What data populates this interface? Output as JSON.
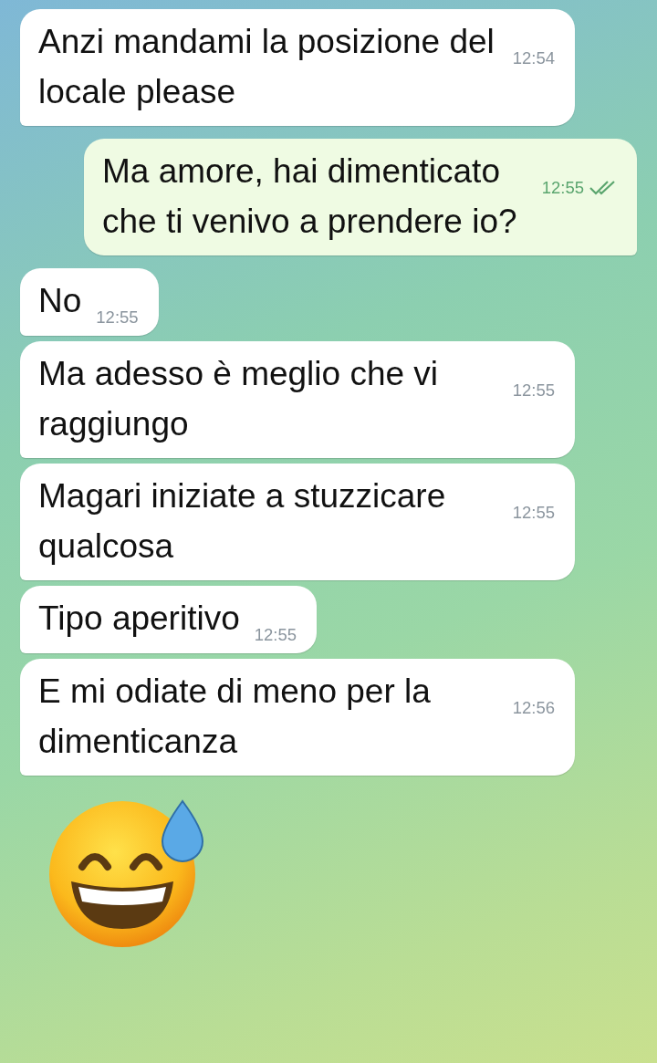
{
  "messages": [
    {
      "kind": "incoming",
      "text": "Anzi mandami la posizione del locale please",
      "time": "12:54"
    },
    {
      "kind": "outgoing",
      "text": "Ma amore, hai dimenticato che ti venivo a prendere io?",
      "time": "12:55",
      "read": true
    },
    {
      "kind": "incoming",
      "text": "No",
      "time": "12:55"
    },
    {
      "kind": "incoming",
      "text": "Ma adesso è meglio che vi raggiungo",
      "time": "12:55"
    },
    {
      "kind": "incoming",
      "text": "Magari iniziate a stuzzicare qualcosa",
      "time": "12:55"
    },
    {
      "kind": "incoming",
      "text": "Tipo aperitivo",
      "time": "12:55"
    },
    {
      "kind": "incoming",
      "text": "E mi odiate di meno per la dimenticanza",
      "time": "12:56"
    },
    {
      "kind": "emoji"
    }
  ]
}
